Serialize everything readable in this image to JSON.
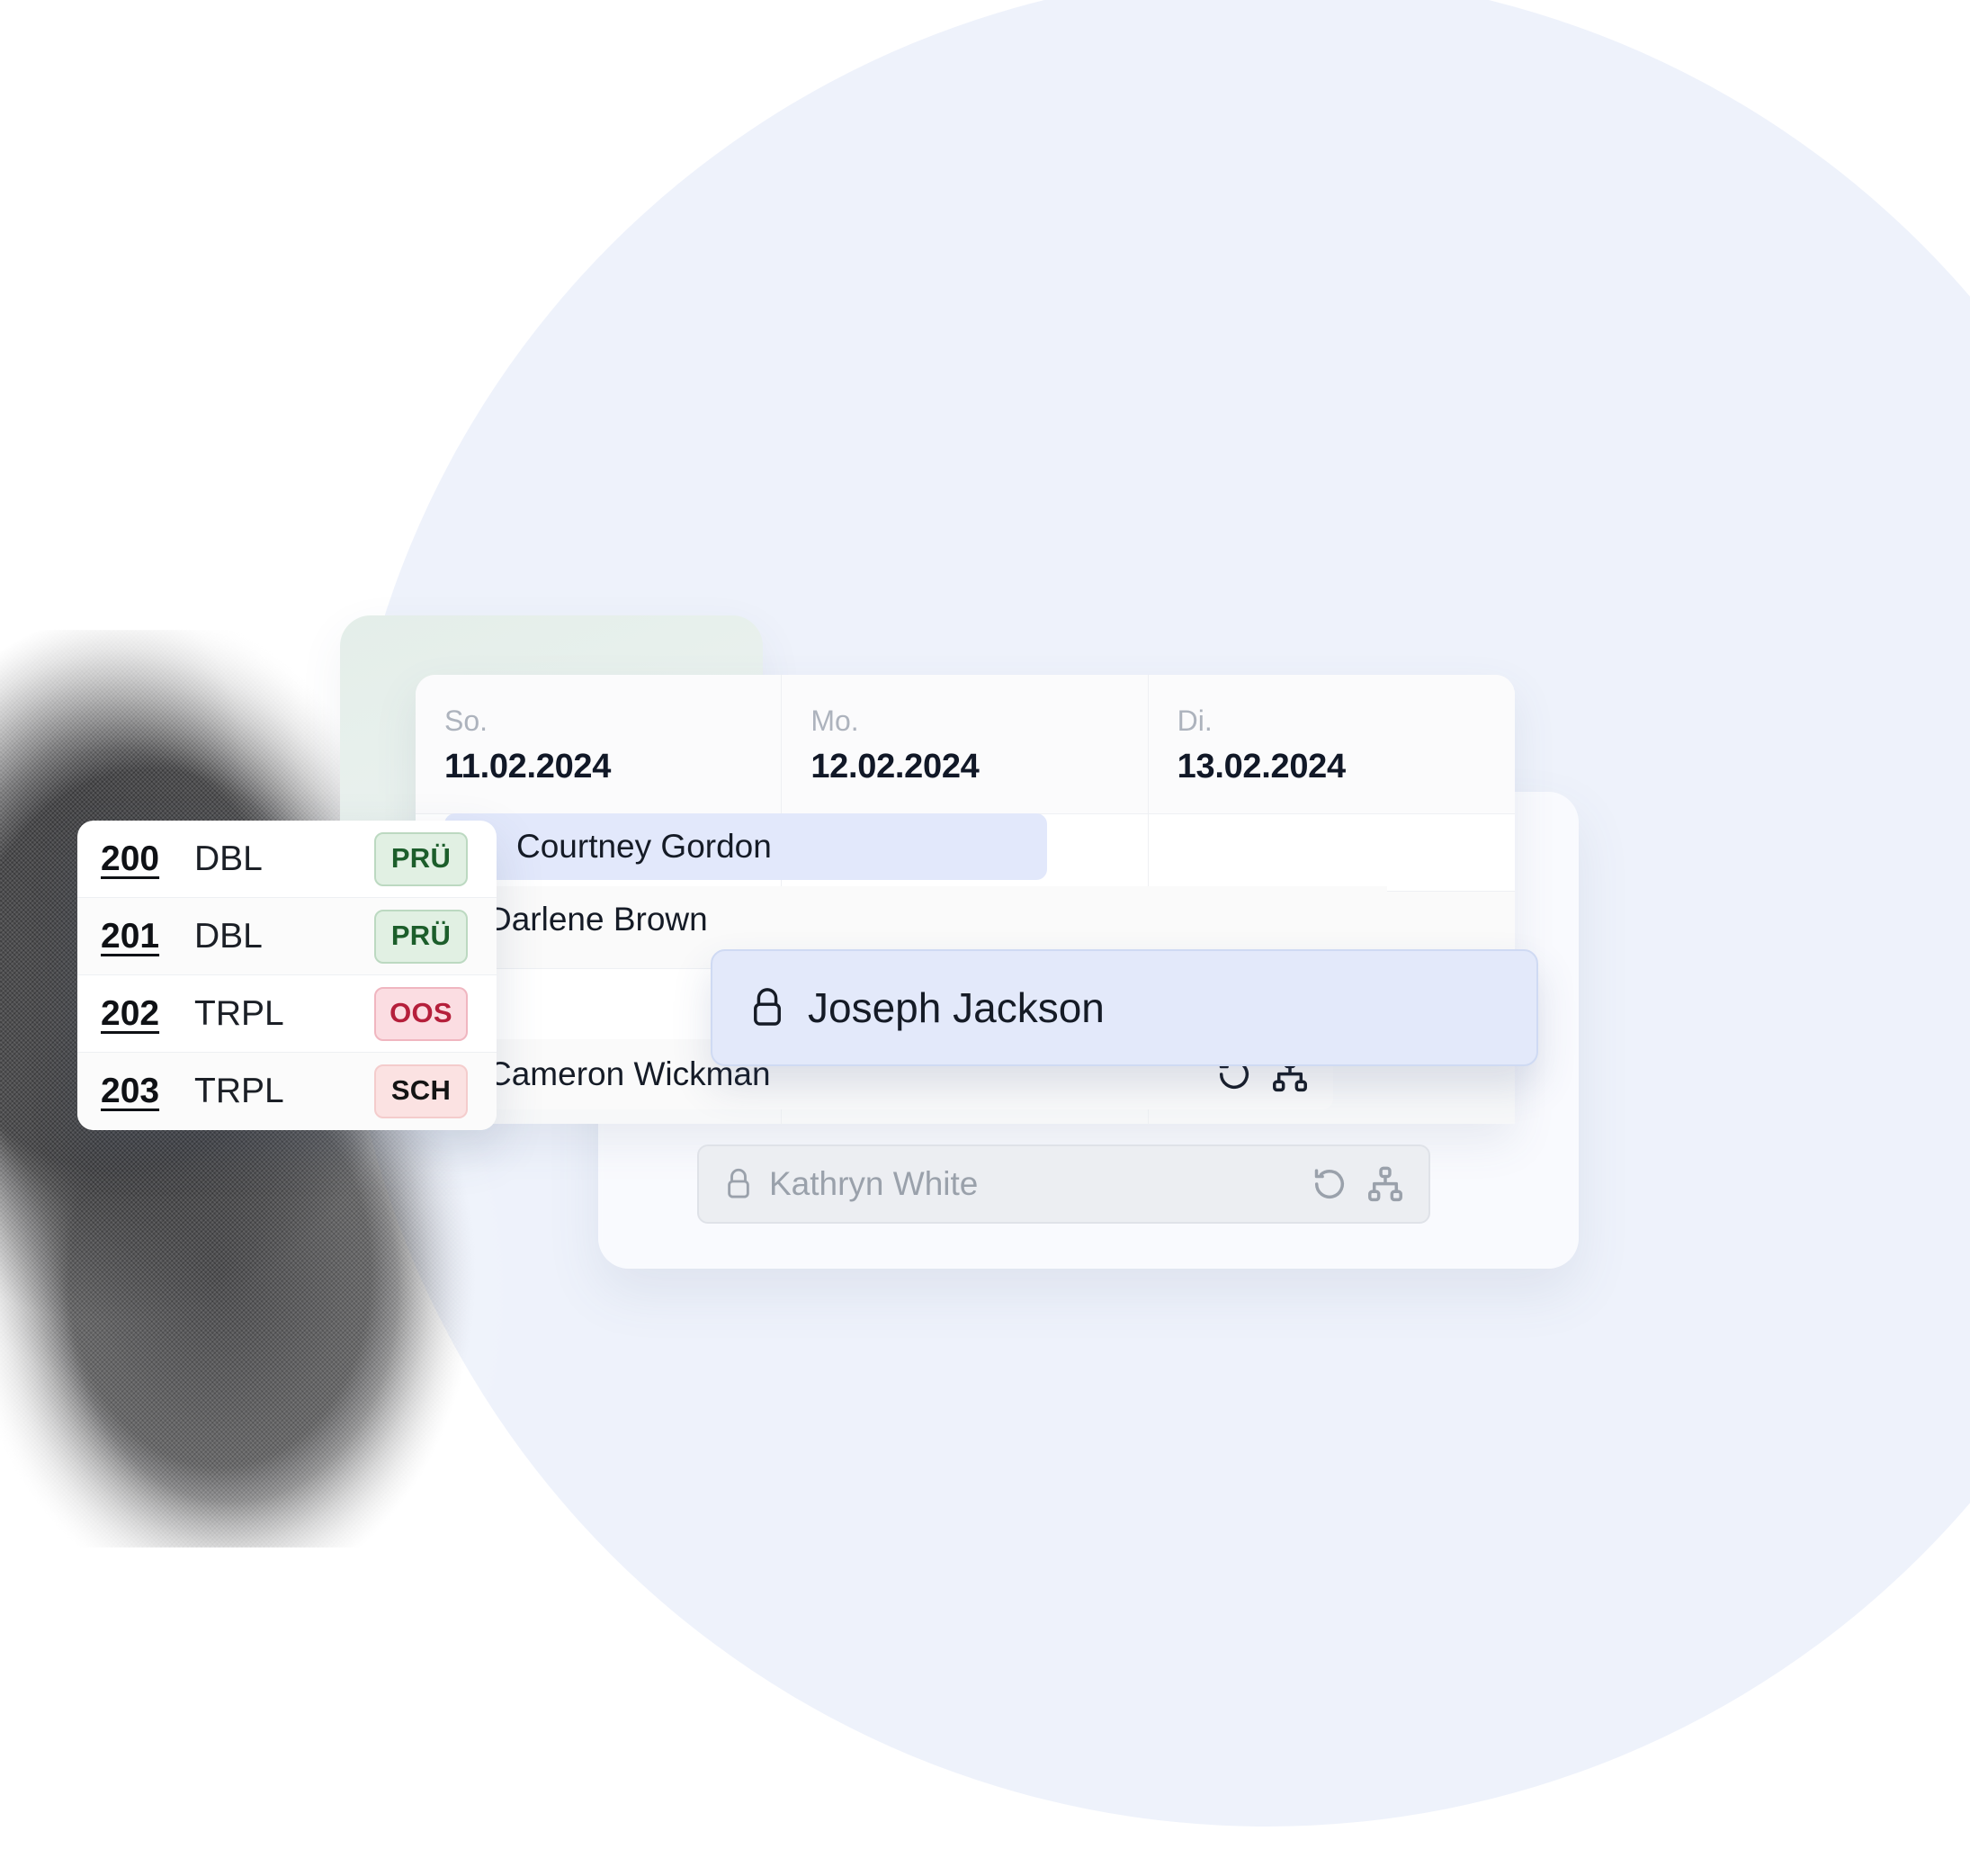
{
  "background": {
    "circle_color": "#eef2fb",
    "blob_color": "#131315"
  },
  "calendar": {
    "columns": [
      {
        "dow": "So.",
        "date": "11.02.2024"
      },
      {
        "dow": "Mo.",
        "date": "12.02.2024"
      },
      {
        "dow": "Di.",
        "date": "13.02.2024"
      }
    ]
  },
  "rooms": {
    "rows": [
      {
        "number": "200",
        "type": "DBL",
        "status": "PRÜ",
        "status_style": "green"
      },
      {
        "number": "201",
        "type": "DBL",
        "status": "PRÜ",
        "status_style": "green"
      },
      {
        "number": "202",
        "type": "TRPL",
        "status": "OOS",
        "status_style": "red"
      },
      {
        "number": "203",
        "type": "TRPL",
        "status": "SCH",
        "status_style": "pink"
      }
    ]
  },
  "bookings": [
    {
      "guest": "Courtney Gordon",
      "lock_icon": "lock-icon",
      "state": "selected"
    },
    {
      "guest": "Darlene Brown",
      "lock_icon": "lock-icon",
      "state": "normal"
    },
    {
      "guest": "Cameron Wickman",
      "lock_icon": "lock-icon",
      "state": "normal",
      "actions": [
        "history-icon",
        "sitemap-icon"
      ]
    }
  ],
  "drag_card": {
    "guest": "Joseph Jackson",
    "lock_icon": "lock-icon"
  },
  "ghost_row": {
    "guest": "Kathryn White",
    "lock_icon": "lock-icon",
    "actions": [
      "history-icon",
      "sitemap-icon"
    ]
  },
  "colors": {
    "selected_chip": "#e2e8fb",
    "drag_card_bg": "#e3e9fa",
    "badge_green_bg": "#e1f0e3",
    "badge_green_text": "#1c5e2b",
    "badge_red_bg": "#fbdde2",
    "badge_red_text": "#b51f3b",
    "badge_pink_bg": "#fbe2e2",
    "badge_pink_text": "#141414"
  }
}
